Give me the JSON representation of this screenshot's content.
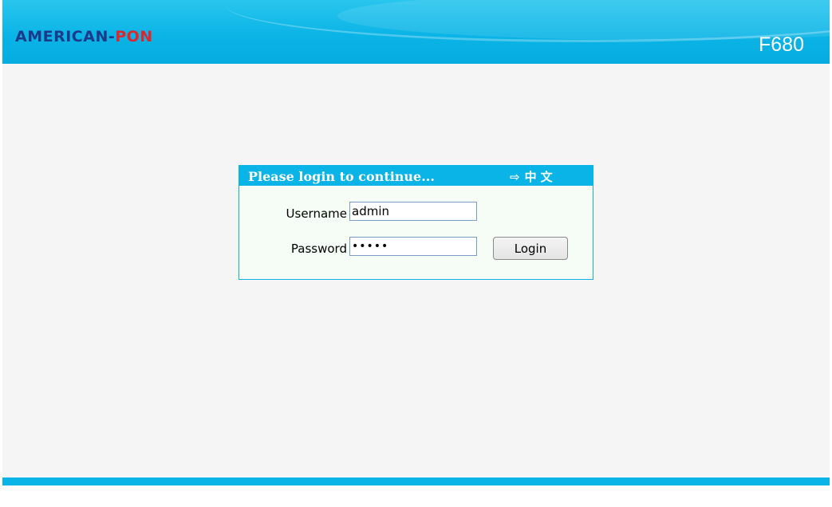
{
  "header": {
    "brand_part1": "AMERICAN-",
    "brand_part2": "PON",
    "model": "F680"
  },
  "login": {
    "title": "Please login to continue...",
    "language_icon": "arrow-right-icon",
    "language_switch": "中文",
    "username_label": "Username",
    "username_value": "admin",
    "password_label": "Password",
    "password_value": "admin",
    "login_button": "Login"
  },
  "colors": {
    "accent": "#0bb4e6",
    "brand_blue": "#1b3a8a",
    "brand_red": "#d9282f",
    "panel_bg": "#f5fdf6",
    "page_bg": "#f5f5f5"
  }
}
